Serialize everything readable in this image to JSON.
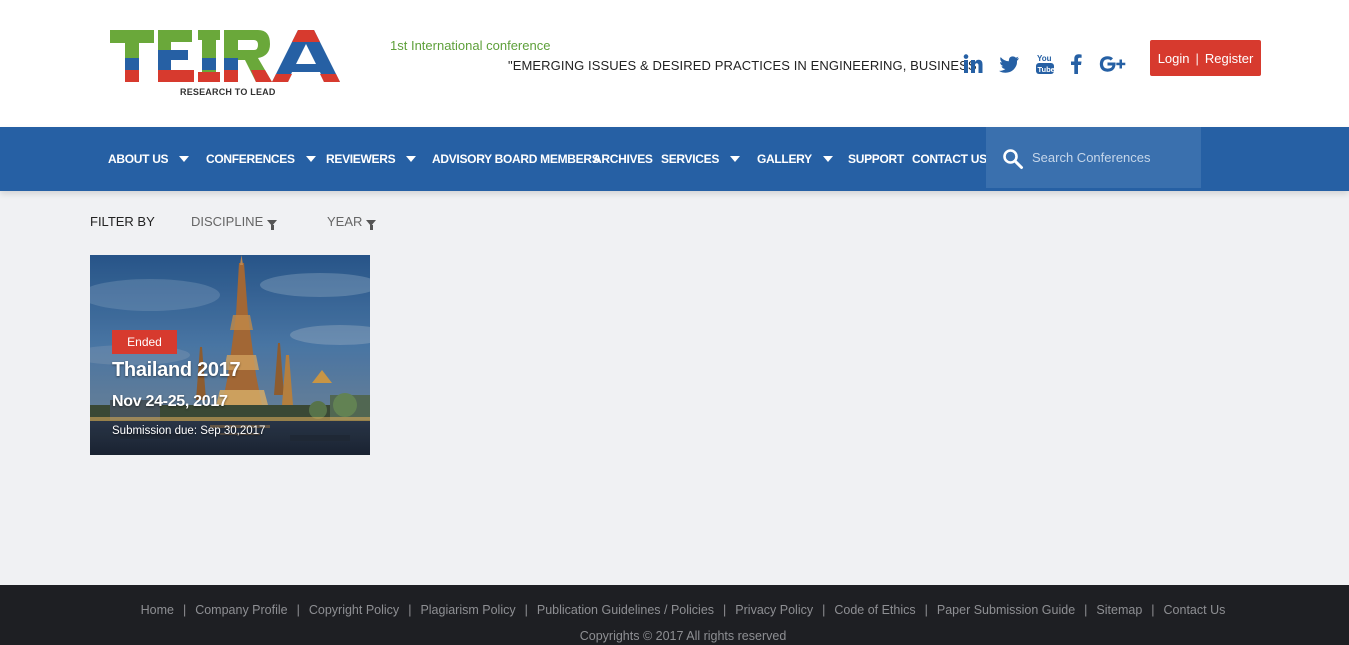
{
  "header": {
    "logo_text": "TEIRA",
    "logo_tagline": "RESEARCH TO LEAD",
    "conference_label": "1st International conference",
    "conference_title": "\"EMERGING ISSUES & DESIRED PRACTICES IN ENGINEERING, BUSINESS",
    "social_icons": [
      "linkedin-icon",
      "twitter-icon",
      "youtube-icon",
      "facebook-icon",
      "google-plus-icon"
    ],
    "login_label": "Login",
    "register_label": "Register",
    "login_separator": "|"
  },
  "nav": {
    "items": [
      {
        "label": "ABOUT US",
        "dropdown": true
      },
      {
        "label": "CONFERENCES",
        "dropdown": true
      },
      {
        "label": "REVIEWERS",
        "dropdown": true
      },
      {
        "label": "ADVISORY BOARD MEMBERS",
        "dropdown": false
      },
      {
        "label": "ARCHIVES",
        "dropdown": false
      },
      {
        "label": "SERVICES",
        "dropdown": true
      },
      {
        "label": "GALLERY",
        "dropdown": true
      },
      {
        "label": "SUPPORT",
        "dropdown": false
      },
      {
        "label": "CONTACT US",
        "dropdown": false
      }
    ],
    "search_placeholder": "Search Conferences"
  },
  "filter": {
    "label": "FILTER BY",
    "discipline": "DISCIPLINE",
    "year": "YEAR"
  },
  "conference_card": {
    "status": "Ended",
    "title": "Thailand 2017",
    "date": "Nov 24-25, 2017",
    "submission_due": "Submission due: Sep 30,2017"
  },
  "footer": {
    "links": [
      "Home",
      "Company Profile",
      "Copyright Policy",
      "Plagiarism Policy",
      "Publication Guidelines / Policies",
      "Privacy Policy",
      "Code of Ethics",
      "Paper Submission Guide",
      "Sitemap",
      "Contact Us"
    ],
    "copyright": "Copyrights © 2017 All rights reserved"
  },
  "colors": {
    "brand_blue": "#2660a4",
    "accent_red": "#d73a2e",
    "logo_green": "#6aa83a",
    "footer_bg": "#1e1f23"
  }
}
